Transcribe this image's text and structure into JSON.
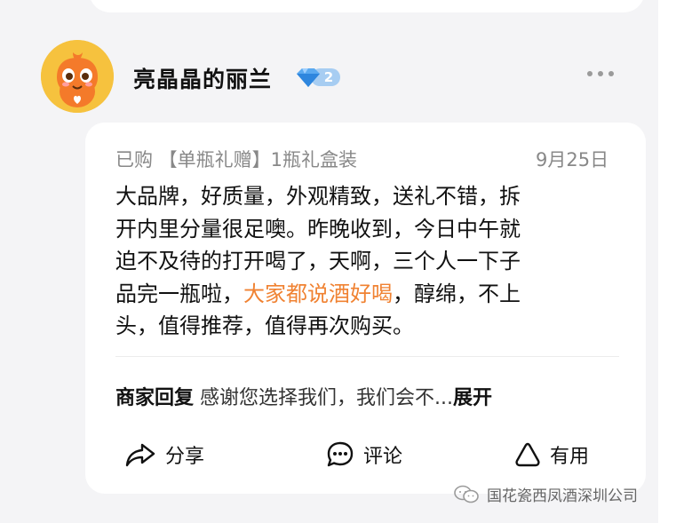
{
  "user": {
    "name": "亮晶晶的丽兰",
    "level": "2"
  },
  "review": {
    "meta": "已购 【单瓶礼赠】1瓶礼盒装",
    "date": "9月25日",
    "lines": [
      "大品牌，好质量，外观精致，送礼不错，拆",
      "开内里分量很足噢。昨晚收到，今日中午就",
      "迫不及待的打开喝了，天啊，三个人一下子"
    ],
    "line4_pre": "品完一瓶啦，",
    "line4_highlight": "大家都说酒好喝",
    "line4_post": "，醇绵，不上",
    "line5": "头，值得推荐，值得再次购买。",
    "highlight_color": "#f08232"
  },
  "reply": {
    "label": "商家回复",
    "text": " 感谢您选择我们，我们会不...",
    "expand": "展开"
  },
  "actions": {
    "share": "分享",
    "comment": "评论",
    "useful": "有用"
  },
  "watermark": "国花瓷西凤酒深圳公司"
}
